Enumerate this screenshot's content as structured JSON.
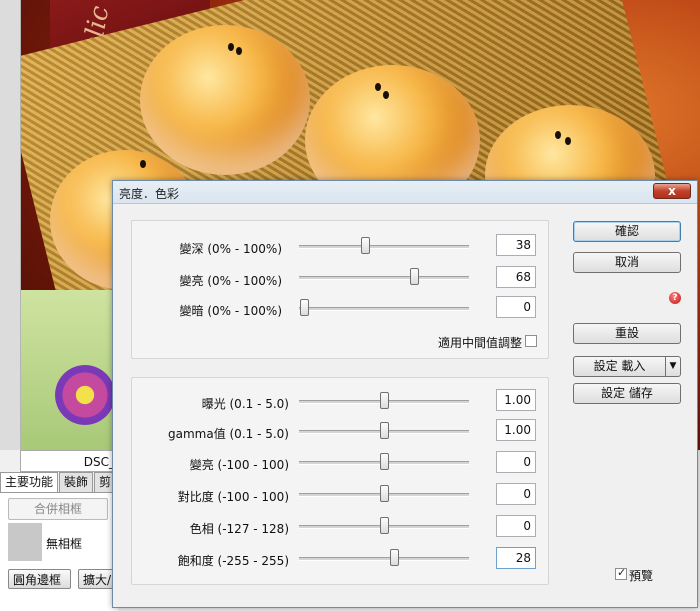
{
  "dialog": {
    "title": "亮度．色彩",
    "close_label": "x",
    "group1": {
      "rows": [
        {
          "label": "變深 (0% - 100%)",
          "value": "38",
          "level": 0.38
        },
        {
          "label": "變亮 (0% - 100%)",
          "value": "68",
          "level": 0.68
        },
        {
          "label": "變暗 (0% - 100%)",
          "value": "0",
          "level": 0.0
        }
      ],
      "midtone_label": "適用中間值調整"
    },
    "group2": {
      "rows": [
        {
          "label": "曝光 (0.1 - 5.0)",
          "value": "1.00"
        },
        {
          "label": "gamma值 (0.1 - 5.0)",
          "value": "1.00"
        },
        {
          "label": "變亮 (-100 - 100)",
          "value": "0"
        },
        {
          "label": "對比度 (-100 - 100)",
          "value": "0"
        },
        {
          "label": "色相 (-127 - 128)",
          "value": "0"
        },
        {
          "label": "飽和度 (-255 - 255)",
          "value": "28"
        }
      ]
    },
    "buttons": {
      "ok": "確認",
      "cancel": "取消",
      "reset": "重設",
      "load": "設定 載入",
      "save": "設定 儲存"
    },
    "preview_label": "預覽"
  },
  "host": {
    "caption": "DSC_",
    "tabs": [
      "主要功能",
      "裝飾",
      "剪"
    ],
    "merge_label": "合併相框",
    "frame_label": "無相框",
    "corner_button": "圓角邊框",
    "zoom_button": "擴大/"
  },
  "photo": {
    "text": "Delic"
  }
}
